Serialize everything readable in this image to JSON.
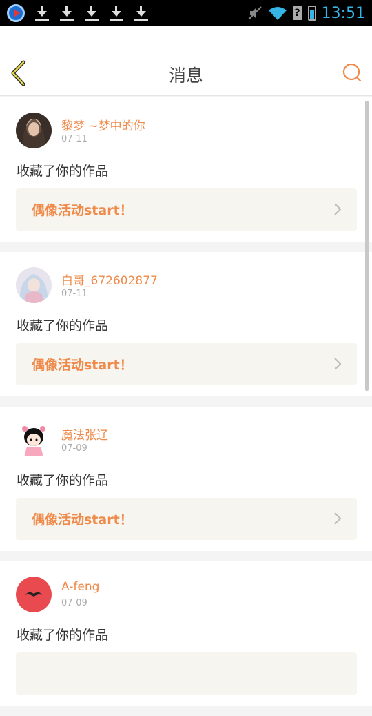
{
  "status_bar": {
    "time": "13:51",
    "icons": [
      "app-icon",
      "download-icon",
      "download-icon",
      "download-icon",
      "download-icon",
      "download-icon",
      "mute-icon",
      "wifi-icon",
      "no-sim-icon",
      "battery-charging-icon"
    ],
    "time_color": "#35b5e5"
  },
  "header": {
    "title": "消息",
    "back_icon": "chevron-left-icon",
    "search_icon": "search-icon",
    "accent": "#ef8a4a"
  },
  "messages": [
    {
      "user": "黎梦 ~梦中的你",
      "date": "07-11",
      "action": "收藏了你的作品",
      "work": "偶像活动start！",
      "avatar": "photo-girl"
    },
    {
      "user": "白哥_672602877",
      "date": "07-11",
      "action": "收藏了你的作品",
      "work": "偶像活动start！",
      "avatar": "anime-girl"
    },
    {
      "user": "魔法张辽",
      "date": "07-09",
      "action": "收藏了你的作品",
      "work": "偶像活动start！",
      "avatar": "cartoon-girl"
    },
    {
      "user": "A-feng",
      "date": "07-09",
      "action": "收藏了你的作品",
      "work": "",
      "avatar": "mustache"
    }
  ]
}
